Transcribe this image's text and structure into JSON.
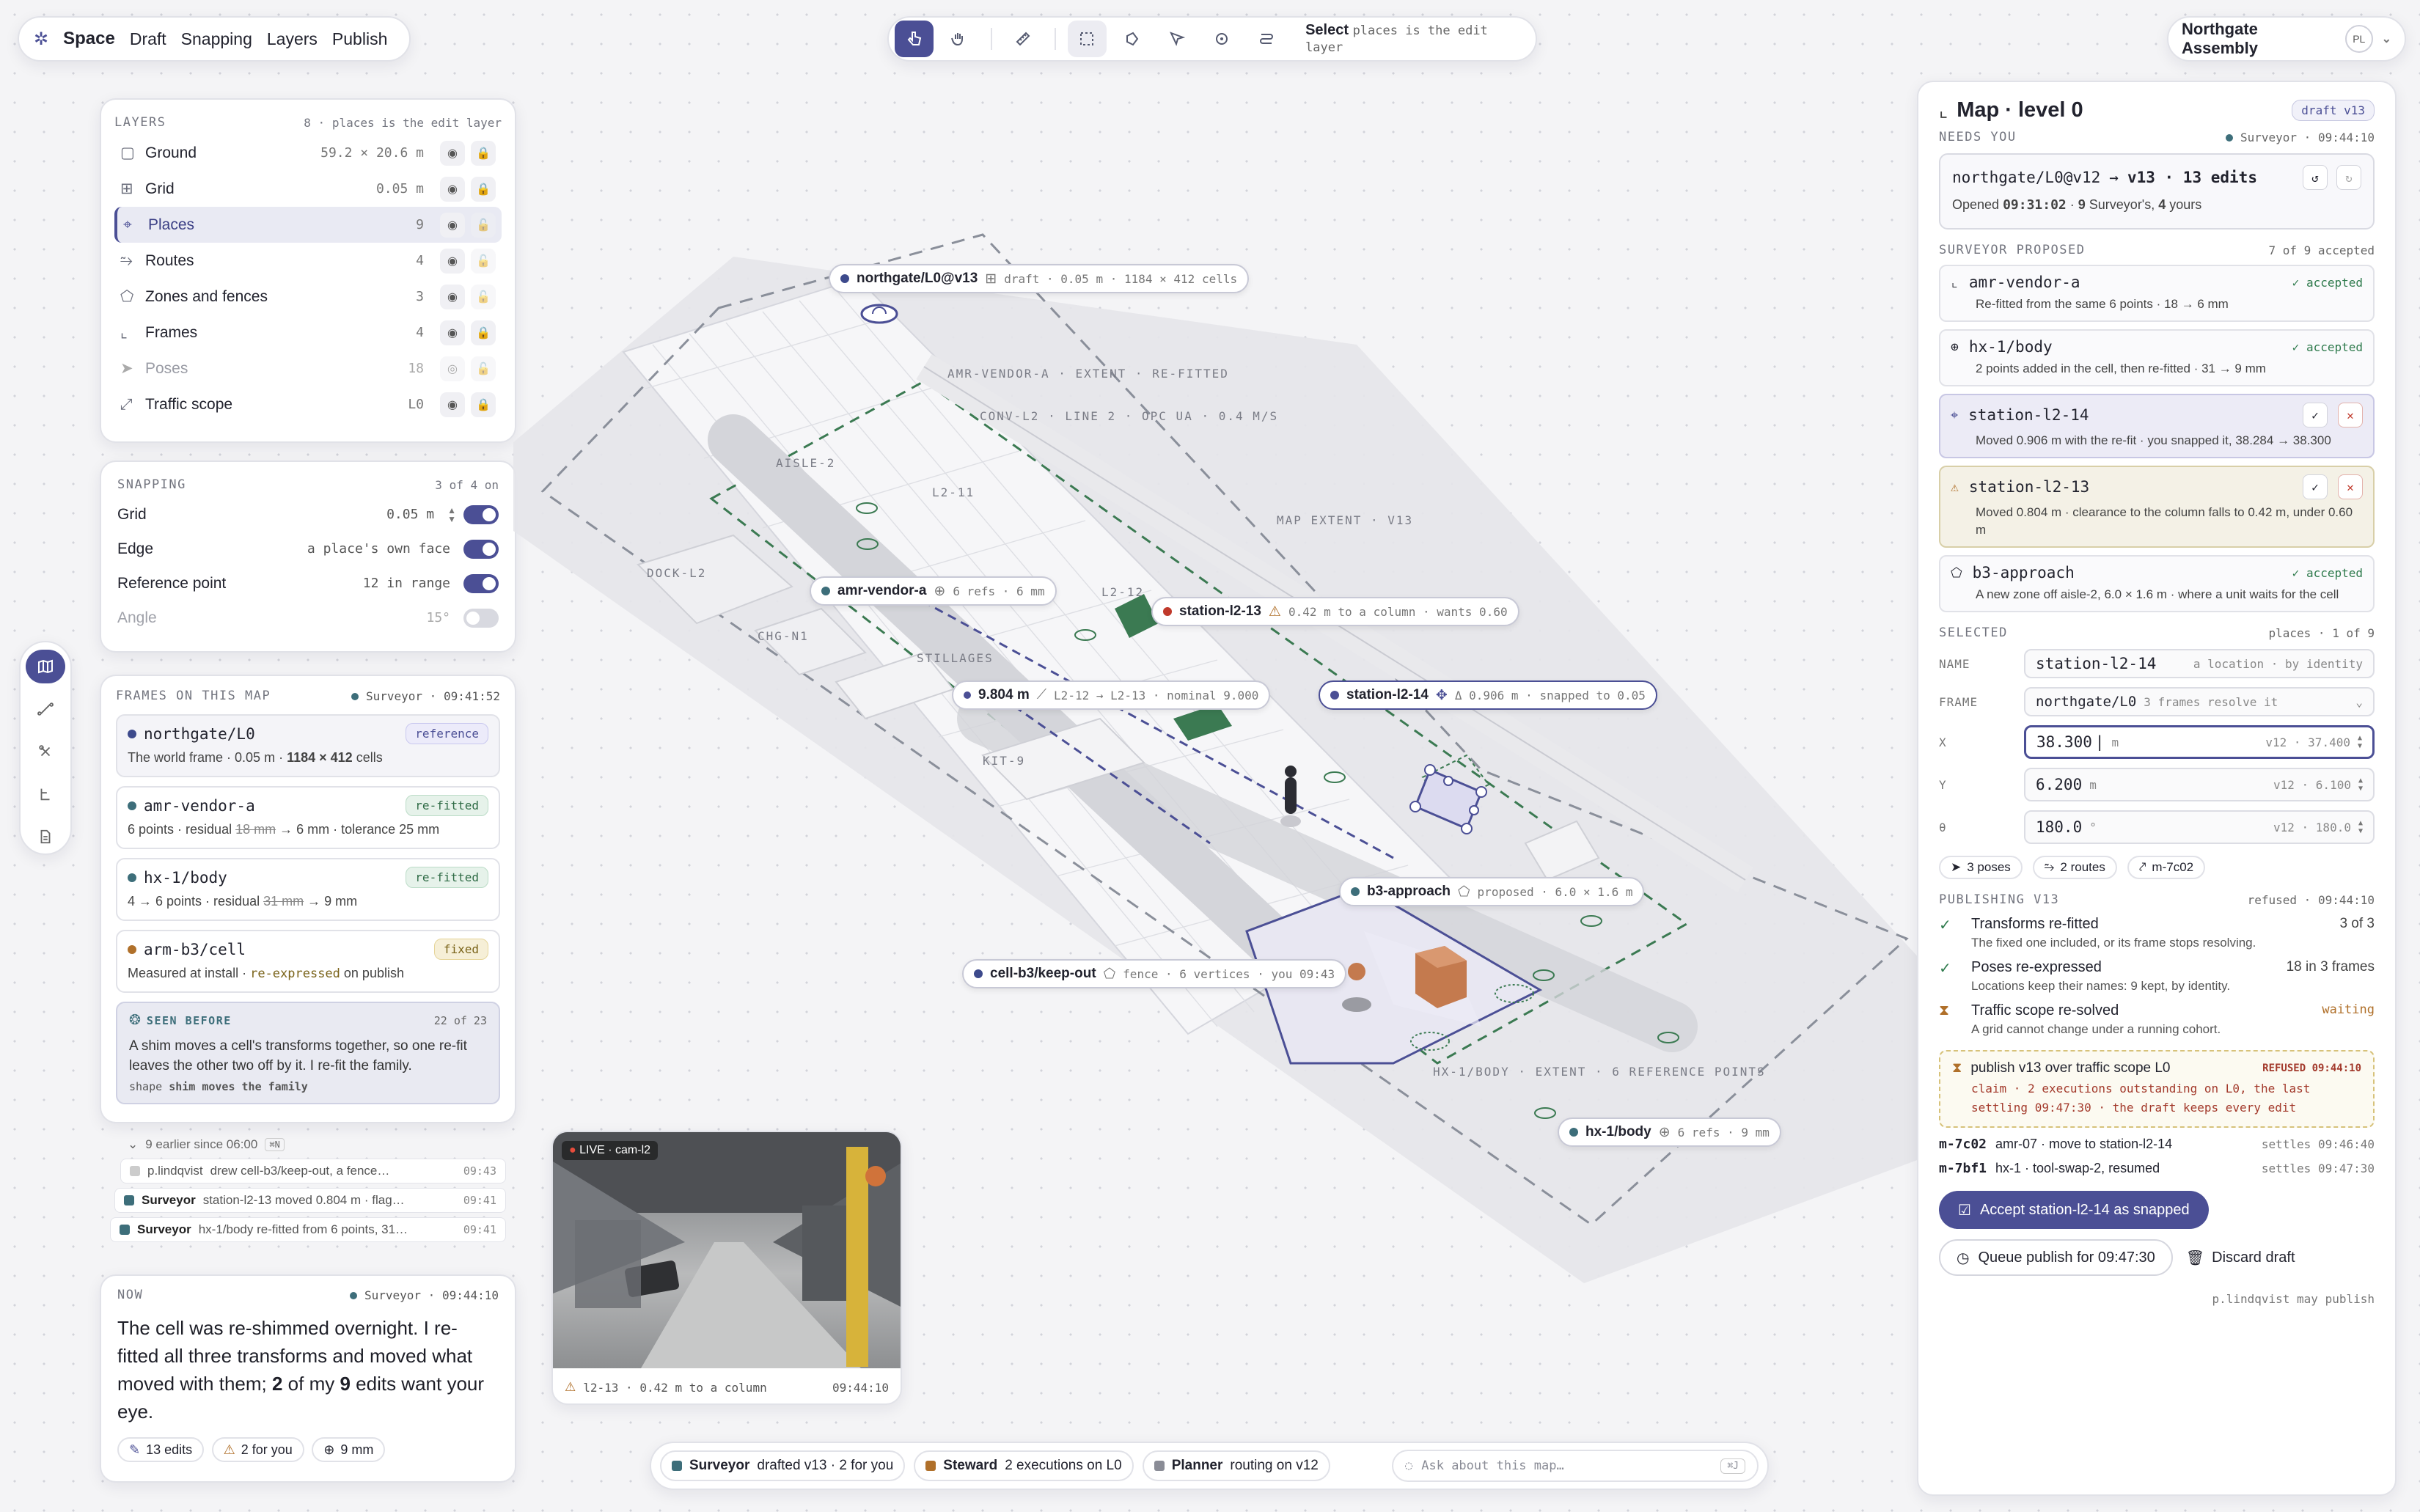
{
  "topbar": {
    "brand": "Space",
    "menu": [
      "Draft",
      "Snapping",
      "Layers",
      "Publish"
    ],
    "hint_prefix": "Select",
    "hint_rest": "places is the edit layer",
    "workspace": "Northgate Assembly",
    "avatar": "PL"
  },
  "layers": {
    "title": "LAYERS",
    "meta": "8 · places is the edit layer",
    "items": [
      {
        "name": "Ground",
        "value": "59.2 × 20.6 m"
      },
      {
        "name": "Grid",
        "value": "0.05 m"
      },
      {
        "name": "Places",
        "value": "9"
      },
      {
        "name": "Routes",
        "value": "4"
      },
      {
        "name": "Zones and fences",
        "value": "3"
      },
      {
        "name": "Frames",
        "value": "4"
      },
      {
        "name": "Poses",
        "value": "18"
      },
      {
        "name": "Traffic scope",
        "value": "L0"
      }
    ]
  },
  "snapping": {
    "title": "SNAPPING",
    "meta": "3 of 4 on",
    "items": [
      {
        "name": "Grid",
        "value": "0.05 m"
      },
      {
        "name": "Edge",
        "value": "a place's own face"
      },
      {
        "name": "Reference point",
        "value": "12 in range"
      },
      {
        "name": "Angle",
        "value": "15°"
      }
    ]
  },
  "frames": {
    "title": "FRAMES ON THIS MAP",
    "who": "Surveyor",
    "time": "09:41:52",
    "items": [
      {
        "name": "northgate/L0",
        "badge": "reference",
        "d1": "The world frame · 0.05 m · ",
        "d2": "1184 × 412",
        "d3": " cells"
      },
      {
        "name": "amr-vendor-a",
        "badge": "re-fitted",
        "d1": "6 points · residual ",
        "strike": "18 mm",
        "d2": " → 6 mm",
        "d3": " · tolerance 25 mm"
      },
      {
        "name": "hx-1/body",
        "badge": "re-fitted",
        "d1": "4 → 6 points · residual ",
        "strike": "31 mm",
        "d2": " → 9 mm",
        "d3": ""
      },
      {
        "name": "arm-b3/cell",
        "badge": "fixed",
        "d1": "Measured at install · ",
        "d2": "re-expressed",
        "d3": " on publish"
      }
    ],
    "seen": {
      "title": "SEEN BEFORE",
      "count": "22 of 23",
      "text": "A shim moves a cell's transforms together, so one re-fit leaves the other two off by it. I re-fit the family.",
      "shape_label": "shape",
      "shape": "shim moves the family"
    }
  },
  "activity": {
    "earlier": "9 earlier since 06:00",
    "kbd": "⌘N",
    "rows": [
      {
        "who": "p.lindqvist",
        "text": "drew cell-b3/keep-out, a fence…",
        "time": "09:43"
      },
      {
        "who": "Surveyor",
        "text": "station-l2-13 moved 0.804 m · flag…",
        "time": "09:41"
      },
      {
        "who": "Surveyor",
        "text": "hx-1/body re-fitted from 6 points, 31…",
        "time": "09:41"
      }
    ]
  },
  "now": {
    "label": "NOW",
    "who": "Surveyor",
    "time": "09:44:10",
    "m1": "The cell was re-shimmed overnight. I re-fitted all three transforms and moved what moved with them; ",
    "m2": "2",
    "m3": " of my ",
    "m4": "9",
    "m5": " edits want your eye.",
    "chips": [
      "13 edits",
      "2 for you",
      "9 mm"
    ]
  },
  "camera": {
    "live": "LIVE · cam-l2",
    "caption": "l2-13 · 0.42 m to a column",
    "time": "09:44:10"
  },
  "map": {
    "pills": [
      {
        "id": "northgate",
        "title": "northgate/L0@v13",
        "sub": "draft · 0.05 m · 1184 × 412 cells"
      },
      {
        "id": "amr",
        "title": "amr-vendor-a",
        "sub": "6 refs · 6 mm"
      },
      {
        "id": "st13",
        "title": "station-l2-13",
        "sub": "0.42 m to a column · wants 0.60"
      },
      {
        "id": "dist",
        "title": "9.804 m",
        "sub": "L2-12 → L2-13 · nominal 9.000"
      },
      {
        "id": "st14",
        "title": "station-l2-14",
        "sub": "Δ 0.906 m · snapped to 0.05"
      },
      {
        "id": "b3",
        "title": "b3-approach",
        "sub": "proposed · 6.0 × 1.6 m"
      },
      {
        "id": "cell",
        "title": "cell-b3/keep-out",
        "sub": "fence · 6 vertices · you 09:43"
      },
      {
        "id": "hx",
        "title": "hx-1/body",
        "sub": "6 refs · 9 mm"
      }
    ],
    "labels": [
      "AMR-VENDOR-A · EXTENT · RE-FITTED",
      "CONV-L2 · LINE 2 · OPC UA · 0.4 M/S",
      "MAP EXTENT · V13",
      "AISLE-2",
      "L2-11",
      "DOCK-L2",
      "CHG-N1",
      "STILLAGES",
      "L2-12",
      "KIT-9",
      "HX-1/BODY · EXTENT · 6 REFERENCE POINTS"
    ]
  },
  "agents": [
    {
      "name": "Surveyor",
      "text": "drafted v13 · 2 for you",
      "color": "#3d6e7a"
    },
    {
      "name": "Steward",
      "text": "2 executions on L0",
      "color": "#b0702a"
    },
    {
      "name": "Planner",
      "text": "routing on v12",
      "color": "#8a8c96"
    }
  ],
  "ask_placeholder": "Ask about this map…",
  "ask_kbd": "⌘J",
  "panel": {
    "title": "Map · level 0",
    "badge": "draft v13",
    "needs": {
      "label": "NEEDS YOU",
      "who": "Surveyor",
      "time": "09:44:10",
      "from": "northgate/L0@v12",
      "to": "v13 · 13 edits",
      "opened": "Opened ",
      "opened_t": "09:31:02",
      "opened_r": " · ",
      "n9": "9",
      "sr": " Surveyor's, ",
      "n4": "4",
      "yours": " yours"
    },
    "proposed": {
      "label": "SURVEYOR PROPOSED",
      "meta": "7 of 9 accepted",
      "items": [
        {
          "name": "amr-vendor-a",
          "status": "accepted",
          "desc": "Re-fitted from the same 6 points · 18 → 6 mm"
        },
        {
          "name": "hx-1/body",
          "status": "accepted",
          "desc": "2 points added in the cell, then re-fitted · 31 → 9 mm"
        },
        {
          "name": "station-l2-14",
          "status": "",
          "desc": "Moved 0.906 m with the re-fit · you snapped it, 38.284 → 38.300"
        },
        {
          "name": "station-l2-13",
          "status": "",
          "desc": "Moved 0.804 m · clearance to the column falls to 0.42 m, under 0.60 m"
        },
        {
          "name": "b3-approach",
          "status": "accepted",
          "desc": "A new zone off aisle-2, 6.0 × 1.6 m · where a unit waits for the cell"
        }
      ]
    },
    "selected": {
      "label": "SELECTED",
      "meta": "places · 1 of 9",
      "name_label": "NAME",
      "name": "station-l2-14",
      "name_hint": "a location · by identity",
      "frame_label": "FRAME",
      "frame": "northgate/L0",
      "frame_hint": "3 frames resolve it",
      "x_label": "X",
      "x": "38.300",
      "x_unit": "m",
      "x_prev": "v12 · 37.400",
      "y_label": "Y",
      "y": "6.200",
      "y_unit": "m",
      "y_prev": "v12 · 6.100",
      "t_label": "θ",
      "t": "180.0",
      "t_unit": "°",
      "t_prev": "v12 · 180.0",
      "chips": [
        "3 poses",
        "2 routes",
        "m-7c02"
      ]
    },
    "publishing": {
      "label": "PUBLISHING V13",
      "meta": "refused · 09:44:10",
      "items": [
        {
          "t": "Transforms re-fitted",
          "d": "The fixed one included, or its frame stops resolving.",
          "r": "3 of 3"
        },
        {
          "t": "Poses re-expressed",
          "d": "Locations keep their names: 9 kept, by identity.",
          "r": "18 in 3 frames"
        },
        {
          "t": "Traffic scope re-solved",
          "d": "A grid cannot change under a running cohort.",
          "r": "waiting"
        }
      ],
      "refused_title": "publish v13 over traffic scope L0",
      "refused_tag": "REFUSED 09:44:10",
      "refused_text": "claim · 2 executions outstanding on L0, the last settling 09:47:30 · the draft keeps every edit"
    },
    "missions": [
      {
        "id": "m-7c02",
        "text": "amr-07 · move to station-l2-14",
        "time": "settles 09:46:40"
      },
      {
        "id": "m-7bf1",
        "text": "hx-1 · tool-swap-2, resumed",
        "time": "settles 09:47:30"
      }
    ],
    "accept_btn": "Accept station-l2-14 as snapped",
    "queue_btn": "Queue publish for 09:47:30",
    "discard_btn": "Discard draft",
    "footer": "p.lindqvist may publish"
  },
  "colors": {
    "accent": "#4b4f95",
    "ok": "#2e7a4c",
    "warn": "#b0702a",
    "error": "#c0392b"
  }
}
